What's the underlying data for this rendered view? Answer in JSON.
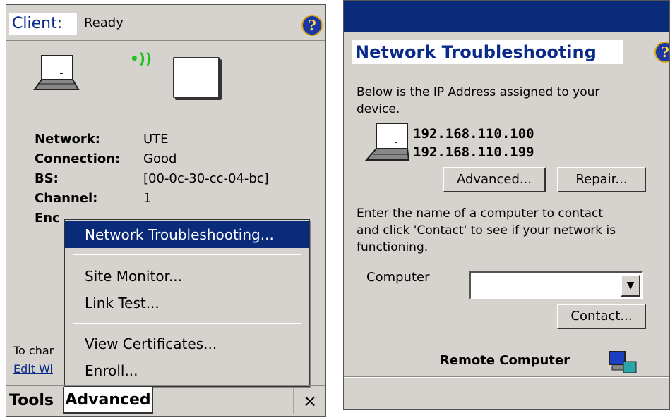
{
  "left": {
    "title": {
      "app": "Client:",
      "status": "Ready"
    },
    "info": [
      {
        "label": "Network:",
        "value": "UTE"
      },
      {
        "label": "Connection:",
        "value": "Good"
      },
      {
        "label": "BS:",
        "value": "[00-0c-30-cc-04-bc]"
      },
      {
        "label": "Channel:",
        "value": "1"
      },
      {
        "label": "Enc",
        "value": ""
      }
    ],
    "hint": {
      "text": "To char",
      "link": "Edit Wi"
    },
    "menu": {
      "items": [
        "Network Troubleshooting...",
        "Site Monitor...",
        "Link Test...",
        "View Certificates...",
        "Enroll..."
      ]
    },
    "menubar": {
      "tools": "Tools",
      "advanced": "Advanced",
      "close": "×"
    }
  },
  "right": {
    "title": "Network Troubleshooting",
    "intro": [
      "Below is the IP Address assigned to your",
      "device."
    ],
    "ips": [
      "192.168.110.100",
      "192.168.110.199"
    ],
    "buttons": {
      "advanced": "Advanced...",
      "repair": "Repair...",
      "contact": "Contact..."
    },
    "contact_text": [
      "Enter the name of a computer to contact",
      "and click 'Contact' to see if your network is",
      "functioning."
    ],
    "computer_label": "Computer",
    "computer_value": "",
    "remote_label": "Remote Computer"
  },
  "colors": {
    "title_blue": "#0a2a7a",
    "panel_gray": "#d6d3ce",
    "wifi_green": "#1fc21f"
  }
}
